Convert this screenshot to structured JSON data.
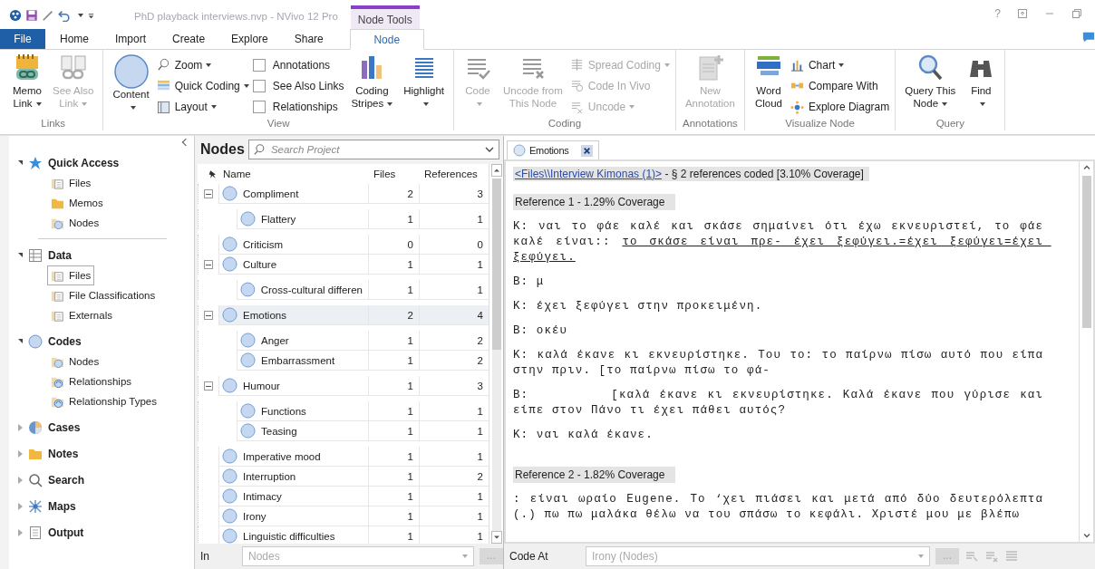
{
  "title_bar": {
    "title": "PhD playback interviews.nvp - NVivo 12 Pro",
    "context_tab": "Node Tools",
    "help": "?"
  },
  "ribbon_tabs": [
    {
      "label": "File",
      "kind": "file",
      "selected": false
    },
    {
      "label": "Home",
      "kind": "tab",
      "selected": false
    },
    {
      "label": "Import",
      "kind": "tab",
      "selected": false
    },
    {
      "label": "Create",
      "kind": "tab",
      "selected": false
    },
    {
      "label": "Explore",
      "kind": "tab",
      "selected": false
    },
    {
      "label": "Share",
      "kind": "tab",
      "selected": false
    },
    {
      "label": "Node",
      "kind": "tab",
      "selected": true
    }
  ],
  "ribbon_groups": [
    {
      "label": "Links",
      "columns": [
        {
          "kind": "large",
          "lines": [
            "Memo",
            "Link"
          ],
          "dropdown": true,
          "disabled": false
        },
        {
          "kind": "large",
          "lines": [
            "See Also",
            "Link"
          ],
          "dropdown": true,
          "disabled": true
        }
      ]
    },
    {
      "label": "View",
      "columns": [
        {
          "kind": "large",
          "lines": [
            "Content"
          ],
          "dropdown": true,
          "disabled": false
        },
        {
          "kind": "stack",
          "items": [
            {
              "kind": "button",
              "label": "Zoom",
              "dropdown": true,
              "disabled": false
            },
            {
              "kind": "button",
              "label": "Quick Coding",
              "dropdown": true,
              "disabled": false
            },
            {
              "kind": "button",
              "label": "Layout",
              "dropdown": true,
              "disabled": false
            }
          ]
        },
        {
          "kind": "stack",
          "items": [
            {
              "kind": "check",
              "label": "Annotations",
              "checked": false
            },
            {
              "kind": "check",
              "label": "See Also Links",
              "checked": false
            },
            {
              "kind": "check",
              "label": "Relationships",
              "checked": false
            }
          ]
        },
        {
          "kind": "large",
          "lines": [
            "Coding",
            "Stripes"
          ],
          "dropdown": true,
          "disabled": false
        },
        {
          "kind": "large",
          "lines": [
            "Highlight"
          ],
          "dropdown": true,
          "disabled": false
        }
      ]
    },
    {
      "label": "Coding",
      "columns": [
        {
          "kind": "large",
          "lines": [
            "Code"
          ],
          "dropdown": true,
          "disabled": true
        },
        {
          "kind": "large",
          "lines": [
            "Uncode from",
            "This Node"
          ],
          "dropdown": false,
          "disabled": true
        },
        {
          "kind": "stack",
          "items": [
            {
              "kind": "button",
              "label": "Spread Coding",
              "dropdown": true,
              "disabled": true
            },
            {
              "kind": "button",
              "label": "Code In Vivo",
              "dropdown": false,
              "disabled": true
            },
            {
              "kind": "button",
              "label": "Uncode",
              "dropdown": true,
              "disabled": true
            }
          ]
        }
      ]
    },
    {
      "label": "Annotations",
      "columns": [
        {
          "kind": "large",
          "lines": [
            "New",
            "Annotation"
          ],
          "dropdown": false,
          "disabled": true
        }
      ]
    },
    {
      "label": "Visualize Node",
      "columns": [
        {
          "kind": "large",
          "lines": [
            "Word",
            "Cloud"
          ],
          "dropdown": false,
          "disabled": false
        },
        {
          "kind": "stack",
          "items": [
            {
              "kind": "button",
              "label": "Chart",
              "dropdown": true,
              "disabled": false
            },
            {
              "kind": "button",
              "label": "Compare With",
              "dropdown": false,
              "disabled": false
            },
            {
              "kind": "button",
              "label": "Explore Diagram",
              "dropdown": false,
              "disabled": false
            }
          ]
        }
      ]
    },
    {
      "label": "Query",
      "columns": [
        {
          "kind": "large",
          "lines": [
            "Query This",
            "Node"
          ],
          "dropdown": true,
          "disabled": false
        },
        {
          "kind": "large",
          "lines": [
            "Find"
          ],
          "dropdown": true,
          "disabled": false
        }
      ]
    }
  ],
  "navigation": [
    {
      "label": "Quick Access",
      "expanded": true,
      "items": [
        {
          "label": "Files",
          "selected": false
        },
        {
          "label": "Memos",
          "selected": false
        },
        {
          "label": "Nodes",
          "selected": false
        }
      ]
    },
    {
      "label": "Data",
      "expanded": true,
      "items": [
        {
          "label": "Files",
          "selected": true
        },
        {
          "label": "File Classifications",
          "selected": false
        },
        {
          "label": "Externals",
          "selected": false
        }
      ]
    },
    {
      "label": "Codes",
      "expanded": true,
      "items": [
        {
          "label": "Nodes",
          "selected": false
        },
        {
          "label": "Relationships",
          "selected": false
        },
        {
          "label": "Relationship Types",
          "selected": false
        }
      ]
    },
    {
      "label": "Cases",
      "expanded": false
    },
    {
      "label": "Notes",
      "expanded": false
    },
    {
      "label": "Search",
      "expanded": false
    },
    {
      "label": "Maps",
      "expanded": false
    },
    {
      "label": "Output",
      "expanded": false
    }
  ],
  "nodes_pane": {
    "title": "Nodes",
    "search": {
      "placeholder": "Search Project"
    },
    "columns": [
      "Name",
      "Files",
      "References"
    ],
    "rows": [
      {
        "name": "Compliment",
        "files": "2",
        "references": "3",
        "selected": false,
        "expanded": true,
        "children": [
          {
            "name": "Flattery",
            "files": "1",
            "references": "1",
            "selected": false
          }
        ]
      },
      {
        "name": "Criticism",
        "files": "0",
        "references": "0",
        "selected": false
      },
      {
        "name": "Culture",
        "files": "1",
        "references": "1",
        "selected": false,
        "expanded": true,
        "children": [
          {
            "name": "Cross-cultural differen",
            "files": "1",
            "references": "1",
            "selected": false
          }
        ]
      },
      {
        "name": "Emotions",
        "files": "2",
        "references": "4",
        "selected": true,
        "expanded": true,
        "children": [
          {
            "name": "Anger",
            "files": "1",
            "references": "2",
            "selected": false
          },
          {
            "name": "Embarrassment",
            "files": "1",
            "references": "2",
            "selected": false
          }
        ]
      },
      {
        "name": "Humour",
        "files": "1",
        "references": "3",
        "selected": false,
        "expanded": true,
        "children": [
          {
            "name": "Functions",
            "files": "1",
            "references": "1",
            "selected": false
          },
          {
            "name": "Teasing",
            "files": "1",
            "references": "1",
            "selected": false
          }
        ]
      },
      {
        "name": "Imperative mood",
        "files": "1",
        "references": "1",
        "selected": false
      },
      {
        "name": "Interruption",
        "files": "1",
        "references": "2",
        "selected": false
      },
      {
        "name": "Intimacy",
        "files": "1",
        "references": "1",
        "selected": false
      },
      {
        "name": "Irony",
        "files": "1",
        "references": "1",
        "selected": false
      },
      {
        "name": "Linguistic difficulties",
        "files": "1",
        "references": "1",
        "selected": false
      }
    ],
    "footer": {
      "label": "In",
      "value": "Nodes",
      "browse": "..."
    }
  },
  "document": {
    "tab": "Emotions",
    "source_link": "<Files\\\\Interview Kimonas (1)>",
    "source_summary": " - § 2 references coded  [3.10% Coverage]",
    "blocks": [
      {
        "kind": "reference",
        "text": "Reference 1 - 1.29% Coverage"
      },
      {
        "kind": "para",
        "segments": [
          {
            "text": "Κ: ναι το φάε καλέ και σκάσε σημαίνει ότι έχω εκνευριστεί, το φάε καλέ είναι:: ",
            "coded": false
          },
          {
            "text": "το σκάσε είναι πρε- έχει ξεφύγει.=έχει ξεφύγει=έχει ξεφύγει.",
            "coded": true
          }
        ]
      },
      {
        "kind": "para",
        "segments": [
          {
            "text": "Β: μ",
            "coded": false
          }
        ]
      },
      {
        "kind": "para",
        "segments": [
          {
            "text": "Κ: έχει ξεφύγει στην προκειμένη.",
            "coded": false
          }
        ]
      },
      {
        "kind": "para",
        "segments": [
          {
            "text": "Β: οκέυ",
            "coded": false
          }
        ]
      },
      {
        "kind": "para",
        "segments": [
          {
            "text": "Κ: καλά έκανε κι εκνευρίστηκε. Του το: το παίρνω πίσω αυτό που είπα στην πριν. [το παίρνω πίσω το φά-",
            "coded": false
          }
        ]
      },
      {
        "kind": "para",
        "segments": [
          {
            "text": "Β:         [καλά έκανε κι εκνευρίστηκε. Καλά έκανε που γύρισε και είπε στον Πάνο τι έχει πάθει αυτός?",
            "coded": false
          }
        ]
      },
      {
        "kind": "para",
        "segments": [
          {
            "text": "Κ: ναι καλά έκανε.",
            "coded": false
          }
        ]
      },
      {
        "kind": "reference",
        "text": "Reference 2 - 1.82% Coverage"
      },
      {
        "kind": "para",
        "segments": [
          {
            "text": ": είναι ωραίο Eugene. Το ‘χει πιάσει και μετά από δύο δευτερόλεπτα (.) πω πω μαλάκα θέλω να του σπάσω το κεφάλι. Χριστέ μου με βλέπω",
            "coded": false
          }
        ]
      }
    ],
    "footer": {
      "label": "Code At",
      "value": "Irony (Nodes)",
      "browse": "..."
    }
  }
}
